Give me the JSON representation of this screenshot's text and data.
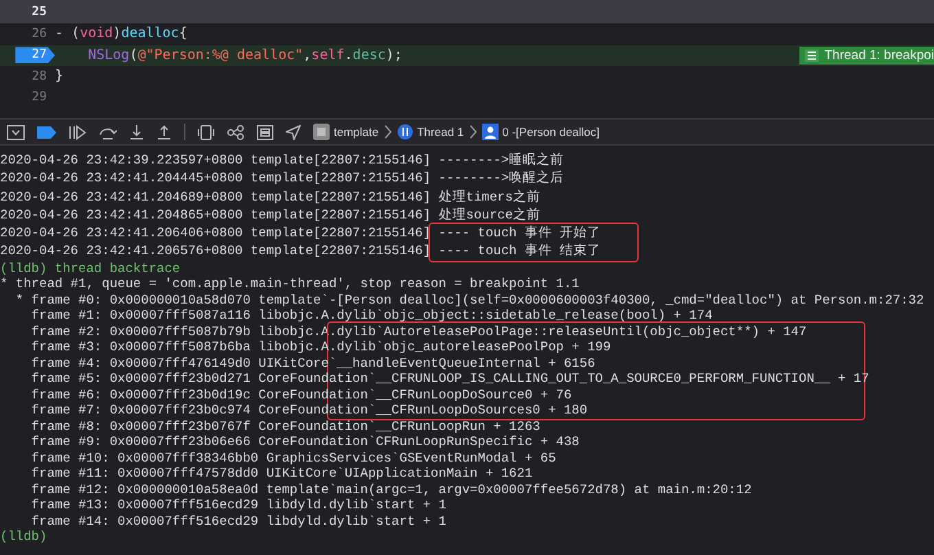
{
  "editor": {
    "lines": [
      {
        "number": "25",
        "current": false,
        "header": true
      },
      {
        "number": "26",
        "current": false,
        "header": false,
        "indented": false,
        "tokens": [
          {
            "text": "- (",
            "kind": "plain"
          },
          {
            "text": "void",
            "kind": "keyword"
          },
          {
            "text": ")",
            "kind": "plain"
          },
          {
            "text": "dealloc",
            "kind": "decl"
          },
          {
            "text": "{",
            "kind": "plain"
          }
        ]
      },
      {
        "number": "27",
        "current": true,
        "header": false,
        "indented": true,
        "tokens": [
          {
            "text": "NSLog",
            "kind": "func"
          },
          {
            "text": "(",
            "kind": "plain"
          },
          {
            "text": "@\"Person:%@ dealloc\"",
            "kind": "string"
          },
          {
            "text": ",",
            "kind": "plain"
          },
          {
            "text": "self",
            "kind": "keyword"
          },
          {
            "text": ".",
            "kind": "plain"
          },
          {
            "text": "desc",
            "kind": "prop"
          },
          {
            "text": ");",
            "kind": "plain"
          }
        ]
      },
      {
        "number": "28",
        "current": false,
        "header": false,
        "indented": false,
        "tokens": [
          {
            "text": "}",
            "kind": "plain"
          }
        ]
      },
      {
        "number": "29",
        "current": false,
        "header": false
      }
    ],
    "breakpoint_badge": "Thread 1: breakpoi"
  },
  "debug_bar": {
    "breadcrumbs": [
      {
        "label": "template",
        "kind": "app"
      },
      {
        "label": "Thread 1",
        "kind": "thread"
      },
      {
        "label": "0 -[Person dealloc]",
        "kind": "frame"
      }
    ]
  },
  "console": {
    "lines": [
      {
        "kind": "log",
        "text": "2020-04-26 23:42:39.223597+0800 template[22807:2155146] -------->睡眠之前",
        "boxed": false
      },
      {
        "kind": "log",
        "text": "2020-04-26 23:42:41.204445+0800 template[22807:2155146] -------->唤醒之后",
        "boxed": false
      },
      {
        "kind": "log",
        "text": "2020-04-26 23:42:41.204689+0800 template[22807:2155146] 处理timers之前",
        "boxed": false
      },
      {
        "kind": "log",
        "text": "2020-04-26 23:42:41.204865+0800 template[22807:2155146] 处理source之前",
        "boxed": false
      },
      {
        "kind": "log",
        "text": "2020-04-26 23:42:41.206406+0800 template[22807:2155146] ---- touch 事件 开始了",
        "boxed": true
      },
      {
        "kind": "log",
        "text": "2020-04-26 23:42:41.206576+0800 template[22807:2155146] ---- touch 事件 结束了",
        "boxed": true
      },
      {
        "kind": "prompt",
        "prompt": "(lldb)",
        "text": "thread backtrace"
      },
      {
        "kind": "output",
        "text": "* thread #1, queue = 'com.apple.main-thread', stop reason = breakpoint 1.1",
        "boxed": false
      },
      {
        "kind": "output",
        "text": "  * frame #0: 0x000000010a58d070 template`-[Person dealloc](self=0x0000600003f40300, _cmd=\"dealloc\") at Person.m:27:32",
        "boxed": false
      },
      {
        "kind": "output",
        "text": "    frame #1: 0x00007fff5087a116 libobjc.A.dylib`objc_object::sidetable_release(bool) + 174",
        "boxed": false
      },
      {
        "kind": "output",
        "text": "    frame #2: 0x00007fff5087b79b libobjc.A.dylib`AutoreleasePoolPage::releaseUntil(objc_object**) + 147",
        "boxed": true
      },
      {
        "kind": "output",
        "text": "    frame #3: 0x00007fff5087b6ba libobjc.A.dylib`objc_autoreleasePoolPop + 199",
        "boxed": true
      },
      {
        "kind": "output",
        "text": "    frame #4: 0x00007fff476149d0 UIKitCore`__handleEventQueueInternal + 6156",
        "boxed": true
      },
      {
        "kind": "output",
        "text": "    frame #5: 0x00007fff23b0d271 CoreFoundation`__CFRUNLOOP_IS_CALLING_OUT_TO_A_SOURCE0_PERFORM_FUNCTION__ + 17",
        "boxed": true
      },
      {
        "kind": "output",
        "text": "    frame #6: 0x00007fff23b0d19c CoreFoundation`__CFRunLoopDoSource0 + 76",
        "boxed": true
      },
      {
        "kind": "output",
        "text": "    frame #7: 0x00007fff23b0c974 CoreFoundation`__CFRunLoopDoSources0 + 180",
        "boxed": true
      },
      {
        "kind": "output",
        "text": "    frame #8: 0x00007fff23b0767f CoreFoundation`__CFRunLoopRun + 1263",
        "boxed": false
      },
      {
        "kind": "output",
        "text": "    frame #9: 0x00007fff23b06e66 CoreFoundation`CFRunLoopRunSpecific + 438",
        "boxed": false
      },
      {
        "kind": "output",
        "text": "    frame #10: 0x00007fff38346bb0 GraphicsServices`GSEventRunModal + 65",
        "boxed": false
      },
      {
        "kind": "output",
        "text": "    frame #11: 0x00007fff47578dd0 UIKitCore`UIApplicationMain + 1621",
        "boxed": false
      },
      {
        "kind": "output",
        "text": "    frame #12: 0x000000010a58ea0d template`main(argc=1, argv=0x00007ffee5672d78) at main.m:20:12",
        "boxed": false
      },
      {
        "kind": "output",
        "text": "    frame #13: 0x00007fff516ecd29 libdyld.dylib`start + 1",
        "boxed": false
      },
      {
        "kind": "output",
        "text": "    frame #14: 0x00007fff516ecd29 libdyld.dylib`start + 1",
        "boxed": false
      },
      {
        "kind": "prompt",
        "prompt": "(lldb)"
      }
    ]
  }
}
